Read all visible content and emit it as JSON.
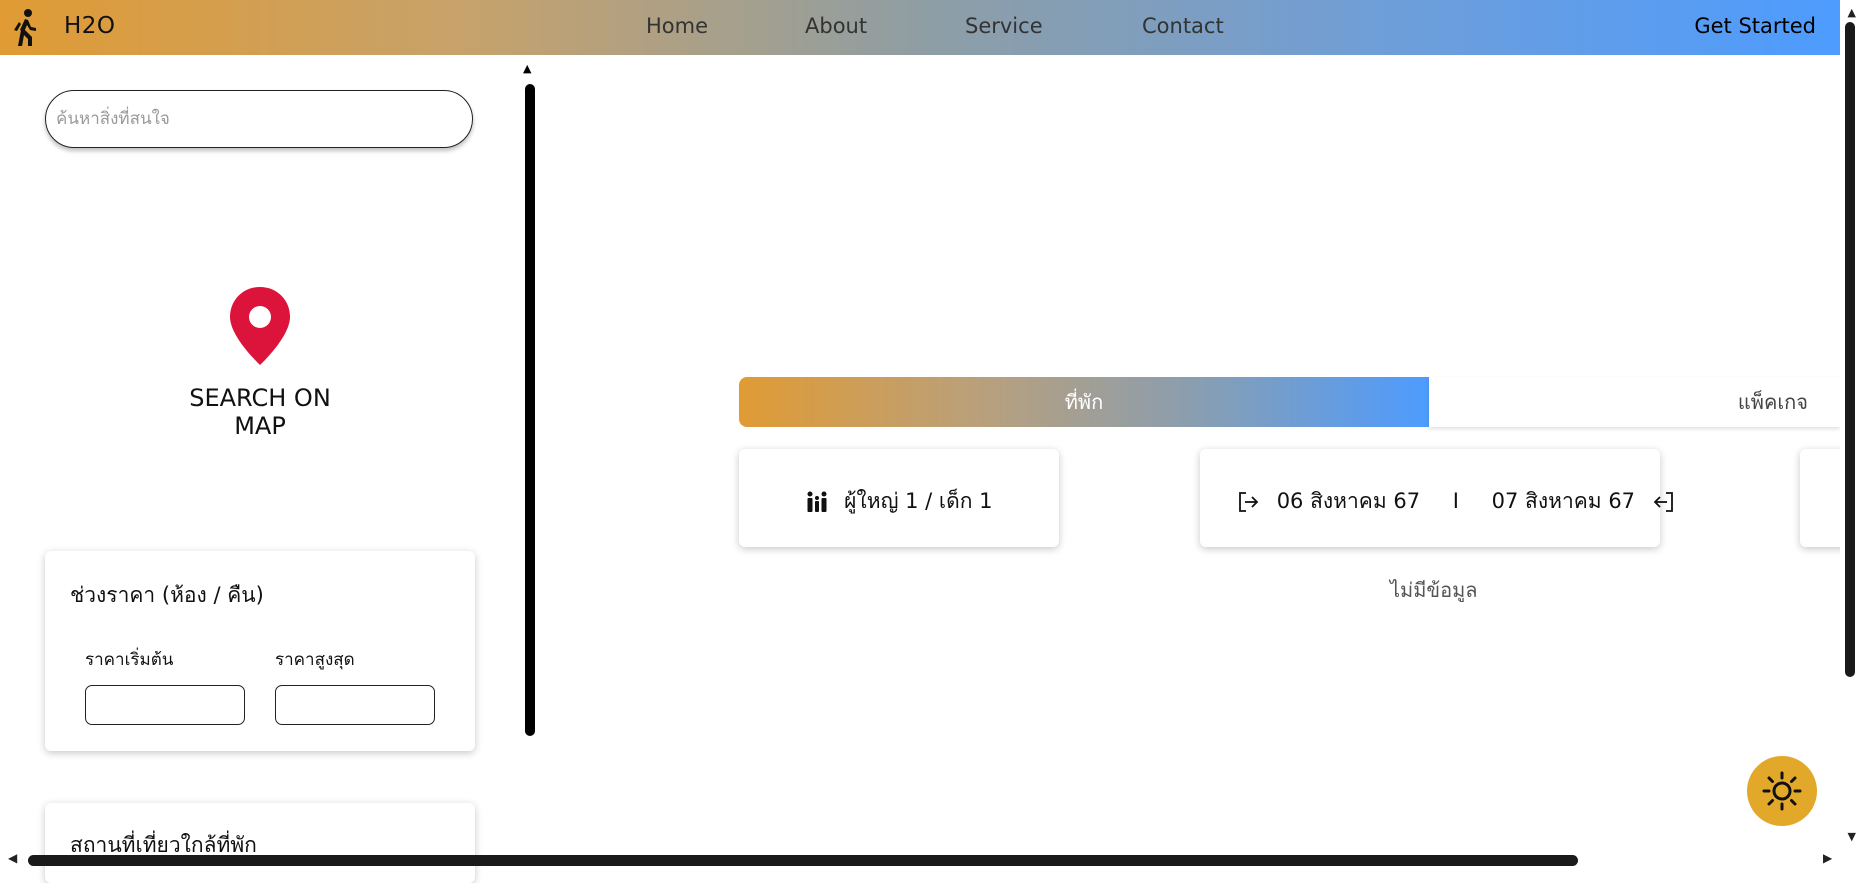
{
  "header": {
    "brand": "H2O",
    "nav": [
      "Home",
      "About",
      "Service",
      "Contact"
    ],
    "cta": "Get Started"
  },
  "sidebar": {
    "search_placeholder": "ค้นหาสิ่งที่สนใจ",
    "map_label": "SEARCH ON MAP",
    "price_card": {
      "title": "ช่วงราคา (ห้อง / คืน)",
      "min_label": "ราคาเริ่มต้น",
      "max_label": "ราคาสูงสุด",
      "min_value": "",
      "max_value": ""
    },
    "nearby_title": "สถานที่เที่ยวใกล้ที่พัก"
  },
  "main": {
    "tabs": [
      "ที่พัก",
      "แพ็คเกจ"
    ],
    "guests": "ผู้ใหญ่ 1 /  เด็ก 1",
    "checkin": "06 สิงหาคม 67",
    "separator": "I",
    "checkout": "07 สิงหาคม 67",
    "no_data": "ไม่มีข้อมูล"
  },
  "icons": {
    "brand": "walking-person-icon",
    "map": "map-pin-icon",
    "guests": "family-icon",
    "checkin": "sign-in-icon",
    "checkout": "sign-out-icon",
    "theme": "sun-icon"
  },
  "colors": {
    "gradient_start": "#e09b34",
    "gradient_end": "#4d9cff",
    "pin": "#dc143c",
    "theme_button": "#e2a82a"
  }
}
